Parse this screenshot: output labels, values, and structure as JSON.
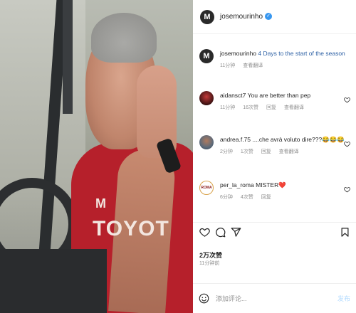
{
  "post": {
    "username": "josemourinho",
    "avatar_text": "M",
    "photo": {
      "shirt_text": "TOYOT",
      "badge_text": "M"
    }
  },
  "caption": {
    "username": "josemourinho",
    "text": "4 Days to the start of the season",
    "time": "11分钟",
    "translate": "查看翻译"
  },
  "comments": [
    {
      "username": "aidansct7",
      "text": "You are better than pep",
      "time": "11分钟",
      "likes": "16次赞",
      "reply": "回复",
      "translate": "查看翻译"
    },
    {
      "username": "andrea.f.75",
      "text": "....che avrà voluto dire???😂😂😂",
      "time": "2分钟",
      "likes": "1次赞",
      "reply": "回复",
      "translate": "查看翻译"
    },
    {
      "username": "per_la_roma",
      "text": "MISTER❤️",
      "time": "6分钟",
      "likes": "4次赞",
      "reply": "回复",
      "avatar_text": "ROMA"
    }
  ],
  "engagement": {
    "likes": "2万次赞",
    "time": "11分钟前"
  },
  "composer": {
    "placeholder": "添加评论...",
    "post_label": "发布"
  },
  "colors": {
    "verified": "#3897f0",
    "post_button": "#b3dbff",
    "shirt": "#b6202b"
  }
}
